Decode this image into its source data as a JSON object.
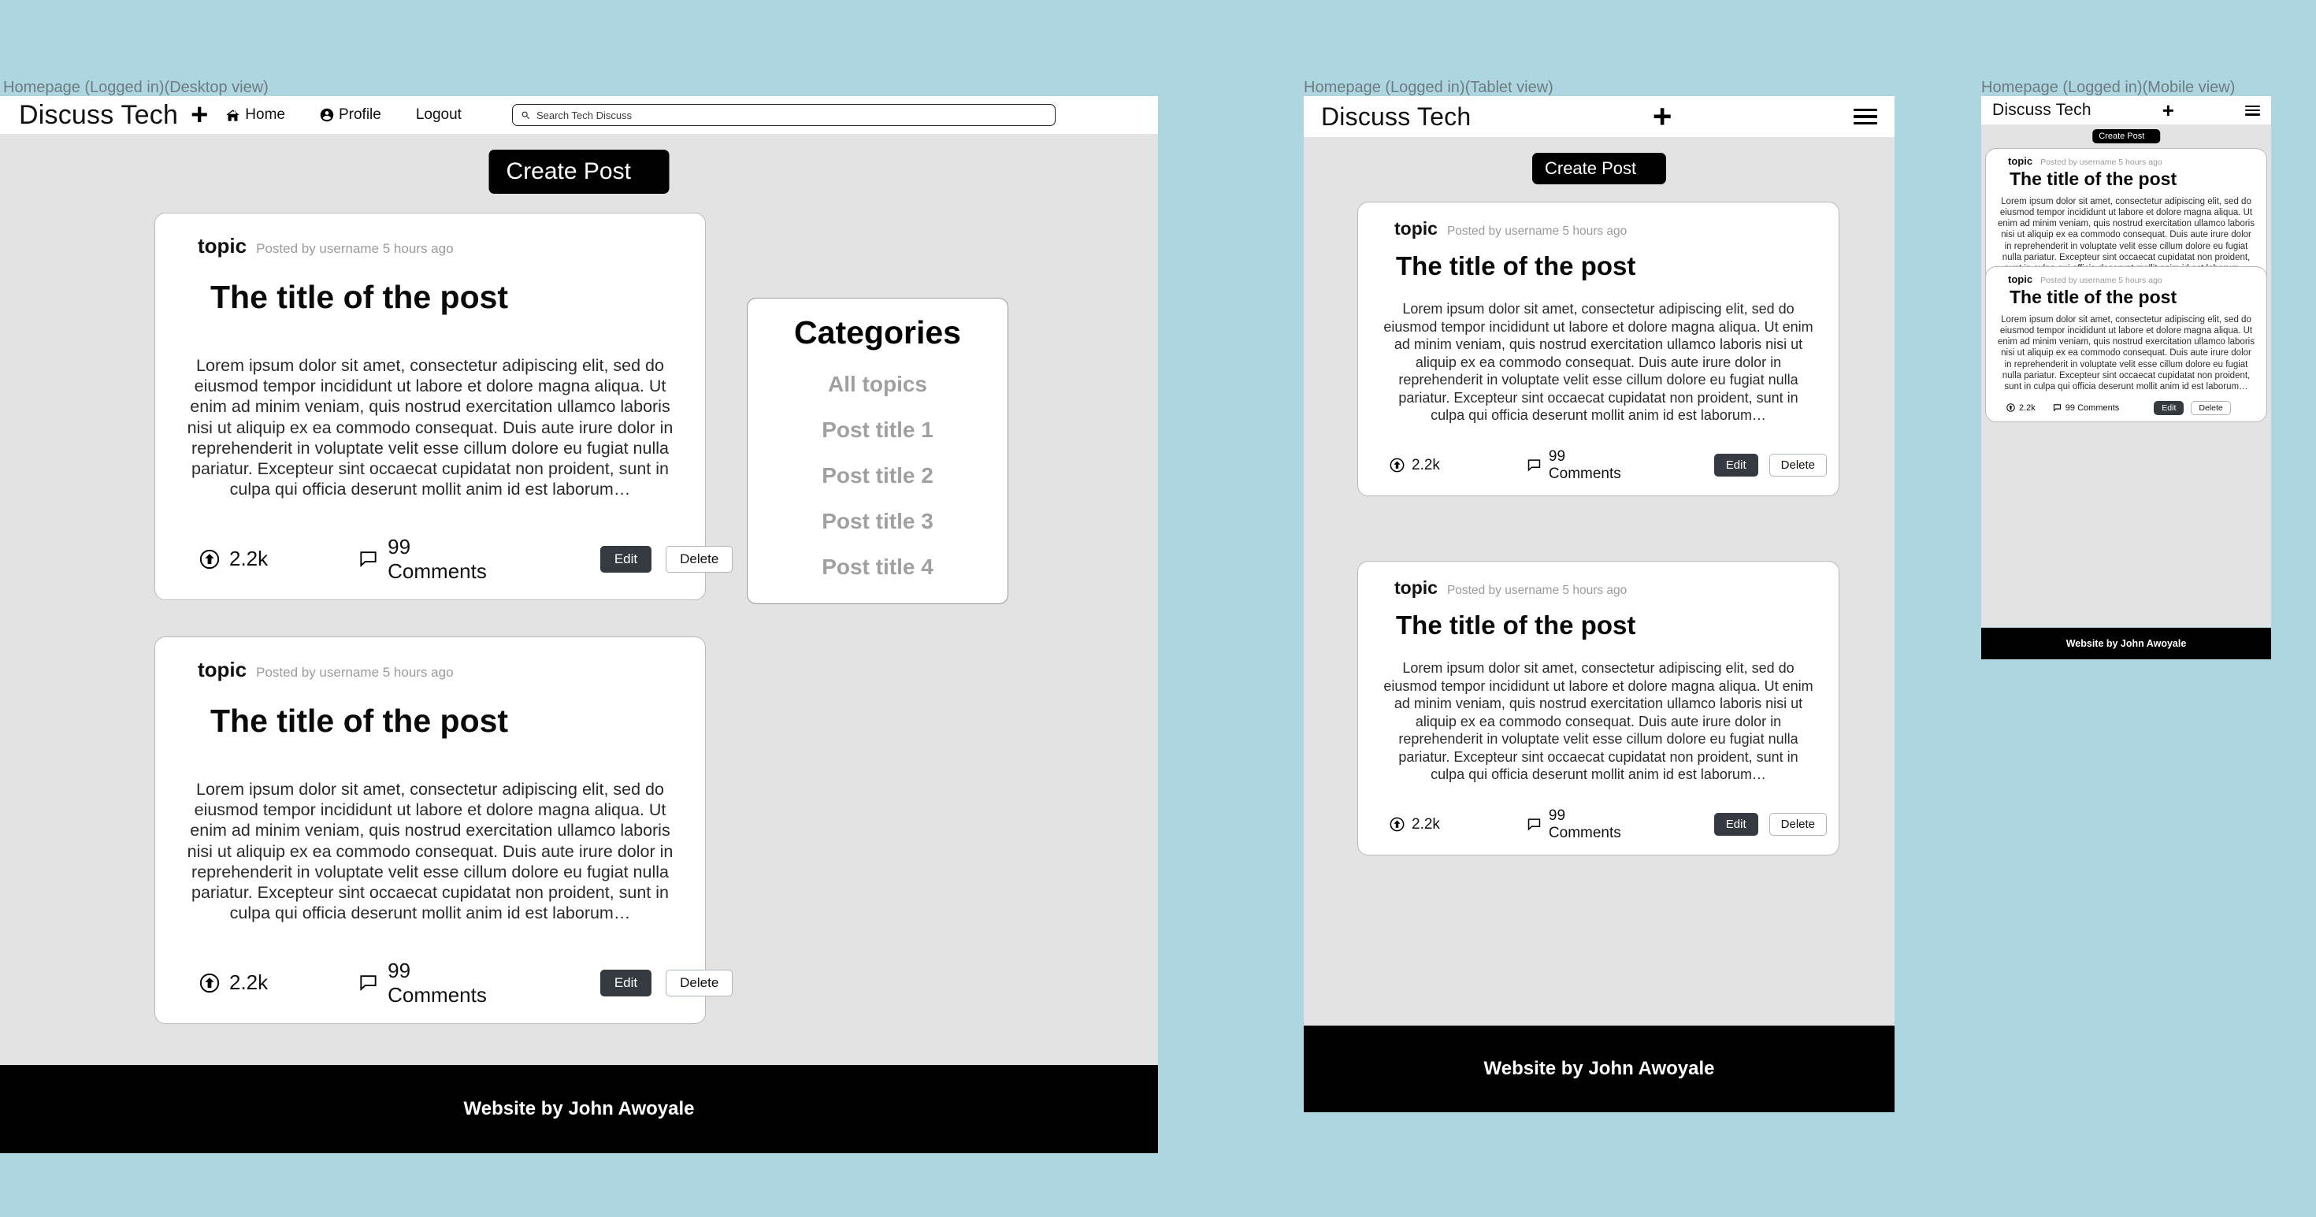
{
  "canvas": {
    "background_color": "#aed6e0",
    "body_color": "#e3e3e3"
  },
  "frames": [
    {
      "caption": "Homepage (Logged in)(Desktop view)"
    },
    {
      "caption": "Homepage (Logged in)(Tablet view)"
    },
    {
      "caption": "Homepage (Logged in)(Mobile view)"
    }
  ],
  "brand": "Discuss Tech",
  "nav": {
    "plus_glyph": "+",
    "links": [
      {
        "label": "Home",
        "icon": "home-icon"
      },
      {
        "label": "Profile",
        "icon": "user-circle-icon"
      },
      {
        "label": "Logout",
        "icon": ""
      }
    ],
    "hamburger_icon": "hamburger-menu-icon"
  },
  "search": {
    "placeholder": "Search Tech Discuss",
    "value": "",
    "icon": "search-icon"
  },
  "actions": {
    "create_post_label": "Create Post",
    "create_post_plus": "+",
    "edit_label": "Edit",
    "delete_label": "Delete"
  },
  "post": {
    "topic": "topic",
    "meta": "Posted by username 5 hours ago",
    "title": "The title of the post",
    "body": "Lorem ipsum dolor sit amet, consectetur adipiscing elit, sed do eiusmod tempor incididunt ut labore et dolore magna aliqua. Ut enim ad minim veniam, quis nostrud exercitation ullamco laboris nisi ut aliquip ex ea commodo consequat. Duis aute irure dolor in reprehenderit in voluptate velit esse cillum dolore eu fugiat nulla pariatur. Excepteur sint occaecat cupidatat non proident, sunt in culpa qui officia deserunt mollit anim id est laborum…",
    "upvotes": "2.2k",
    "upvote_icon": "upvote-arrow-circle-icon",
    "comments": "99 Comments",
    "comment_icon": "comment-bubble-icon"
  },
  "categories": {
    "title": "Categories",
    "items": [
      {
        "label": "All topics"
      },
      {
        "label": "Post title 1"
      },
      {
        "label": "Post title 2"
      },
      {
        "label": "Post title 3"
      },
      {
        "label": "Post  title 4"
      }
    ]
  },
  "footer": {
    "credit": "Website by John Awoyale"
  },
  "colors": {
    "accent_black": "#010101",
    "edit_button": "#343a40",
    "muted_text": "#9b9b9b",
    "category_text": "#a0a0a0"
  }
}
